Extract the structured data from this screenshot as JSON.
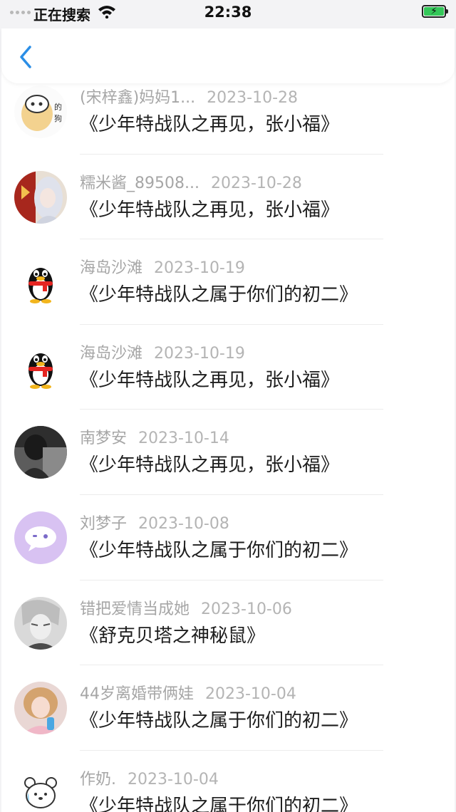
{
  "status_bar": {
    "carrier": "正在搜索",
    "time": "22:38",
    "battery_charging": true
  },
  "nav": {
    "back_icon": "chevron-left-icon",
    "accent_color": "#2b8ee6"
  },
  "records": [
    {
      "user": "(宋梓鑫)妈妈1...",
      "date": "2023-10-28",
      "title": "《少年特战队之再见，张小福》",
      "avatar": "cartoon-dog-avatar"
    },
    {
      "user": "糯米酱_89508...",
      "date": "2023-10-28",
      "title": "《少年特战队之再见，张小福》",
      "avatar": "anime-girl-avatar"
    },
    {
      "user": "海岛沙滩",
      "date": "2023-10-19",
      "title": "《少年特战队之属于你们的初二》",
      "avatar": "qq-penguin-avatar"
    },
    {
      "user": "海岛沙滩",
      "date": "2023-10-19",
      "title": "《少年特战队之再见，张小福》",
      "avatar": "qq-penguin-avatar"
    },
    {
      "user": "南梦安",
      "date": "2023-10-14",
      "title": "《少年特战队之再见，张小福》",
      "avatar": "photo-avatar"
    },
    {
      "user": "刘梦子",
      "date": "2023-10-08",
      "title": "《少年特战队之属于你们的初二》",
      "avatar": "chat-bubble-avatar"
    },
    {
      "user": "错把爱情当成她",
      "date": "2023-10-06",
      "title": "《舒克贝塔之神秘鼠》",
      "avatar": "sketch-boy-avatar"
    },
    {
      "user": "44岁离婚带俩娃",
      "date": "2023-10-04",
      "title": "《少年特战队之属于你们的初二》",
      "avatar": "girl-photo-avatar"
    },
    {
      "user": "作奶.",
      "date": "2023-10-04",
      "title": "《少年特战队之属于你们的初二》",
      "avatar": "cartoon-bear-avatar"
    }
  ]
}
